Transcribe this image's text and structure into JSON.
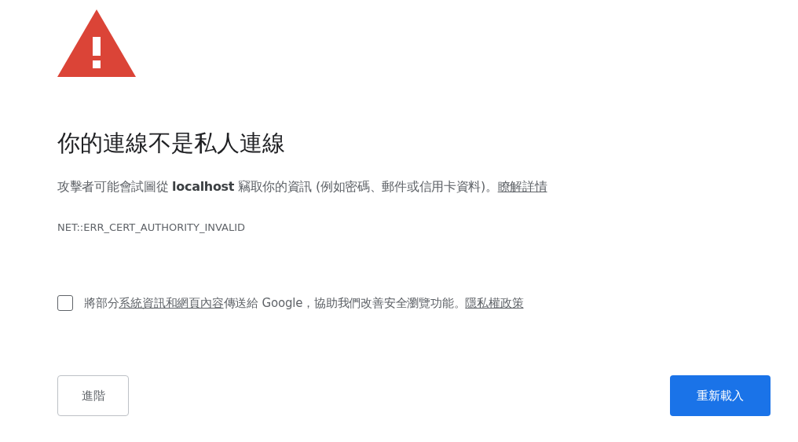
{
  "heading": "你的連線不是私人連線",
  "description": {
    "text": "攻擊者可能會試圖從 **localhost** 竊取你的資訊 (例如密碼、郵件或信用卡資料)。",
    "link": "瞭解詳情"
  },
  "error_code": "NET::ERR_CERT_AUTHORITY_INVALID",
  "report_option": {
    "checked": false,
    "parts": [
      {
        "kind": "text",
        "text": "將部分"
      },
      {
        "kind": "link",
        "text": "系統資訊和網頁內容"
      },
      {
        "kind": "text",
        "text": "傳送給 Google，協助我們改善安全瀏覽功能。"
      },
      {
        "kind": "link",
        "text": "隱私權政策"
      }
    ]
  },
  "buttons": [
    {
      "label": "進階",
      "kind": "secondary"
    },
    {
      "label": "重新載入",
      "kind": "primary"
    }
  ]
}
